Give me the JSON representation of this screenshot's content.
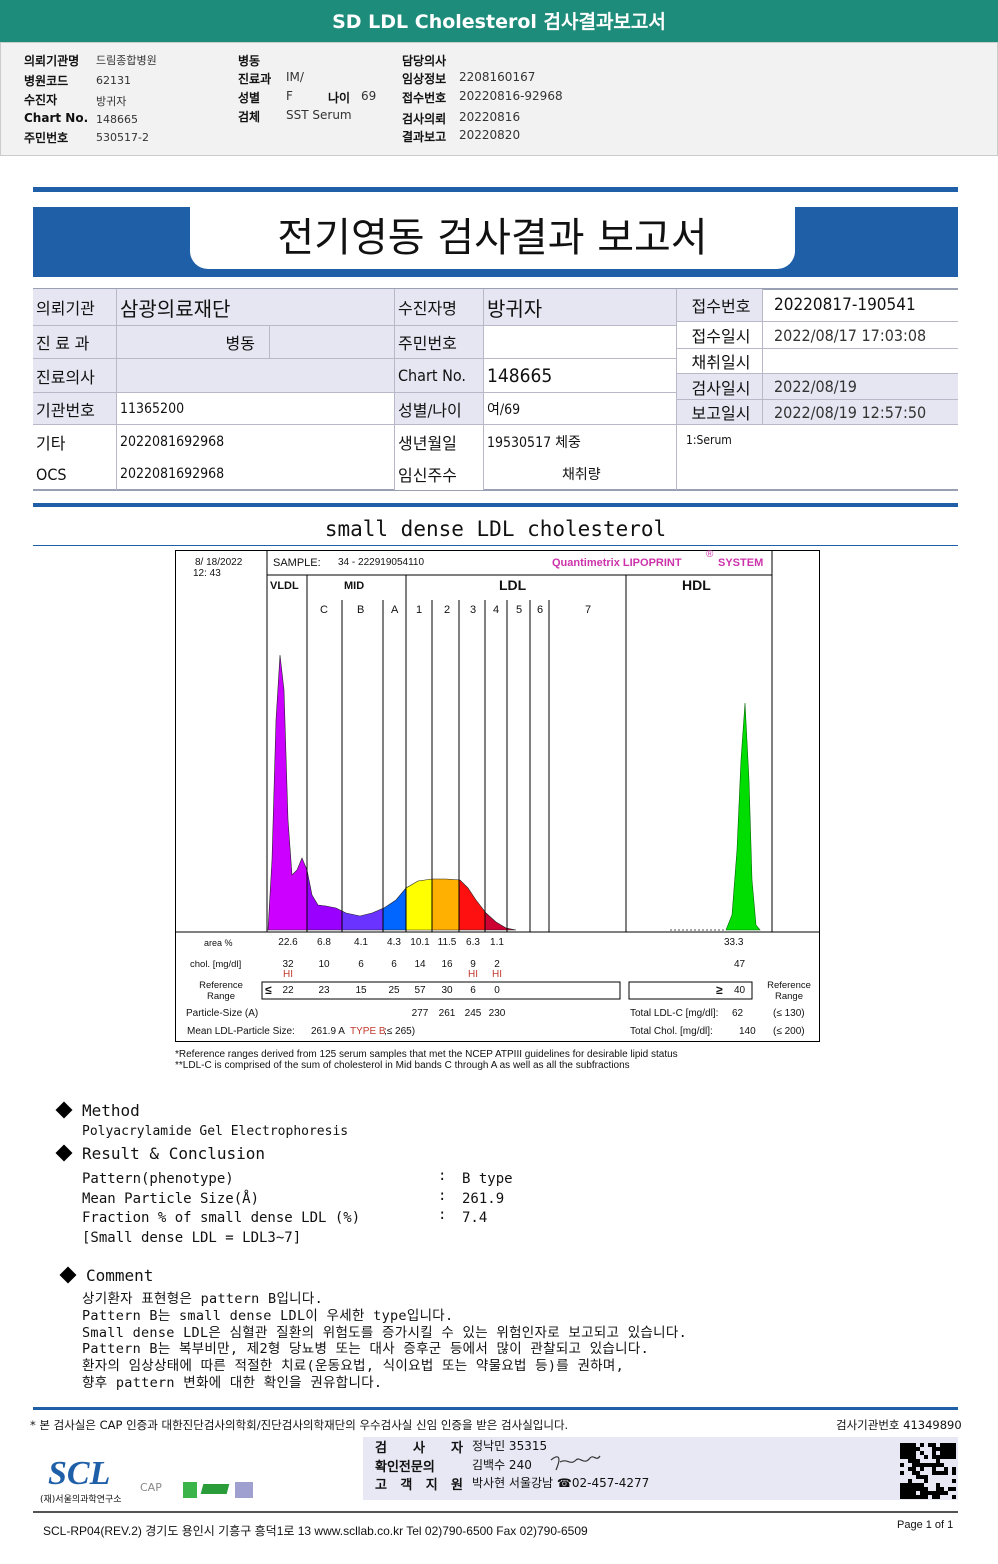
{
  "header": {
    "title": "SD LDL Cholesterol 검사결과보고서"
  },
  "info": {
    "col1": [
      [
        "의뢰기관명",
        "드림종합병원"
      ],
      [
        "병원코드",
        "62131"
      ],
      [
        "수진자",
        "방귀자"
      ],
      [
        "Chart No.",
        "148665"
      ],
      [
        "주민번호",
        "530517-2"
      ]
    ],
    "col2": [
      [
        "병동",
        ""
      ],
      [
        "진료과",
        "IM/"
      ],
      [
        "성별",
        "F"
      ],
      [
        "검체",
        "SST Serum"
      ]
    ],
    "age_label": "나이",
    "age": "69",
    "col3": [
      [
        "담당의사",
        ""
      ],
      [
        "임상정보",
        "2208160167"
      ],
      [
        "접수번호",
        "20220816-92968"
      ],
      [
        "검사의뢰",
        "20220816"
      ],
      [
        "결과보고",
        "20220820"
      ]
    ]
  },
  "report": {
    "title": "전기영동 검사결과 보고서"
  },
  "patient": {
    "l1": "의뢰기관",
    "v1": "삼광의료재단",
    "l2": "진 료 과",
    "v2": "병동",
    "l3": "진료의사",
    "v3": "",
    "l4": "기관번호",
    "v4": "11365200",
    "l5": "기타",
    "v5": "2022081692968",
    "l6": "OCS",
    "v6": "2022081692968",
    "m1": "수진자명",
    "n1": "방귀자",
    "m2": "주민번호",
    "n2": "",
    "m3": "Chart No.",
    "n3": "148665",
    "m4": "성별/나이",
    "n4": "여/69",
    "m5": "생년월일",
    "n5": "19530517 체중",
    "m6": "임신주수",
    "n6": "채취량",
    "r1": "접수번호",
    "s1": "20220817-190541",
    "r2": "접수일시",
    "s2": "2022/08/17 17:03:08",
    "r3": "채취일시",
    "s3": "",
    "r4": "검사일시",
    "s4": "2022/08/19",
    "r5": "보고일시",
    "s5": "2022/08/19 12:57:50",
    "s6": "1:Serum"
  },
  "subtitle": "small dense LDL cholesterol",
  "chart": {
    "date": "8/ 18/2022",
    "time": "12: 43",
    "sample_label": "SAMPLE:",
    "sample": "34 - 222919054110",
    "brand": "Quantimetrix LIPOPRINT",
    "brand_mark": "®",
    "brand2": "SYSTEM",
    "groups": [
      "VLDL",
      "MID",
      "LDL",
      "HDL"
    ],
    "bands": [
      "C",
      "B",
      "A",
      "1",
      "2",
      "3",
      "4",
      "5",
      "6",
      "7"
    ],
    "area_label": "area %",
    "area": [
      "22.6",
      "6.8",
      "4.1",
      "4.3",
      "10.1",
      "11.5",
      "6.3",
      "1.1"
    ],
    "area_hdl": "33.3",
    "chol_label": "chol. [mg/dl]",
    "chol": [
      "32",
      "10",
      "6",
      "6",
      "14",
      "16",
      "9",
      "2"
    ],
    "chol_hdl": "47",
    "flags": [
      "HI",
      "",
      "",
      "",
      "",
      "",
      "HI",
      "HI"
    ],
    "ref_label": "Reference Range",
    "ref_sym": "≤",
    "ref": [
      "22",
      "23",
      "15",
      "25",
      "57",
      "30",
      "6",
      "0"
    ],
    "ref_hdl_sym": "≥",
    "ref_hdl": "40",
    "ps_label": "Particle-Size (A)",
    "ps": [
      "277",
      "261",
      "245",
      "230"
    ],
    "mean_label": "Mean LDL-Particle Size:",
    "mean_value": "261.9 A",
    "mean_type": "TYPE B",
    "mean_ref": ";≤ 265)",
    "tldl_label": "Total LDL-C [mg/dl]:",
    "tldl": "62",
    "tldl_ref": "(≤ 130)",
    "tchol_label": "Total Chol. [mg/dl]:",
    "tchol": "140",
    "tchol_ref": "(≤ 200)",
    "colors": {
      "vldl": "#cc00ff",
      "midc": "#9900ff",
      "midb": "#6a33ff",
      "mida": "#0066ff",
      "ldl1": "#ffff00",
      "ldl2": "#ffb000",
      "ldl3": "#ff1010",
      "ldl4": "#cc0033",
      "hdl": "#00dd00",
      "brand": "#cc33aa",
      "flag": "#c0392b"
    }
  },
  "footnotes": [
    "*Reference ranges derived from 125 serum samples that met the NCEP ATPIII guidelines for desirable lipid status",
    "**LDL-C is comprised of the sum of cholesterol in Mid bands C through A as well as all the subfractions"
  ],
  "method": {
    "title": "Method",
    "text": "Polyacrylamide Gel Electrophoresis"
  },
  "result": {
    "title": "Result & Conclusion",
    "rows": [
      [
        "Pattern(phenotype)",
        ":",
        "B type"
      ],
      [
        "Mean Particle Size(Å)",
        ":",
        "261.9"
      ],
      [
        "Fraction % of small dense LDL (%)",
        ":",
        "7.4"
      ]
    ],
    "note": "[Small dense LDL = LDL3~7]"
  },
  "comment": {
    "title": "Comment",
    "lines": [
      "상기환자 표현형은 pattern B입니다.",
      "Pattern B는 small dense LDL이 우세한 type입니다.",
      "Small dense LDL은 심혈관 질환의 위험도를 증가시킬 수 있는 위험인자로 보고되고 있습니다.",
      "Pattern B는 복부비만, 제2형 당뇨병 또는 대사 증후군 등에서 많이 관찰되고 있습니다.",
      "환자의 임상상태에 따른 적절한 치료(운동요법, 식이요법 또는 약물요법 등)를 권하며,",
      "향후 pattern 변화에 대한 확인을 권유합니다."
    ]
  },
  "footer": {
    "cert": "* 본 검사실은 CAP 인증과 대한진단검사의학회/진단검사의학재단의 우수검사실 신임 인증을 받은 검사실입니다.",
    "org_no": "검사기관번호 41349890",
    "staff": [
      [
        "검 사 자",
        "정낙민 35315"
      ],
      [
        "확인전문의",
        "김백수 240"
      ],
      [
        "고 객 지 원",
        "박사현 서울강남 ☎02-457-4277"
      ]
    ],
    "logo": "SCL",
    "logo_sub": "(재)서울의과학연구소",
    "cap": "CAP",
    "address": "SCL-RP04(REV.2)  경기도 용인시 기흥구 흥덕1로 13  www.scllab.co.kr  Tel 02)790-6500  Fax 02)790-6509",
    "page": "Page 1 of 1"
  }
}
